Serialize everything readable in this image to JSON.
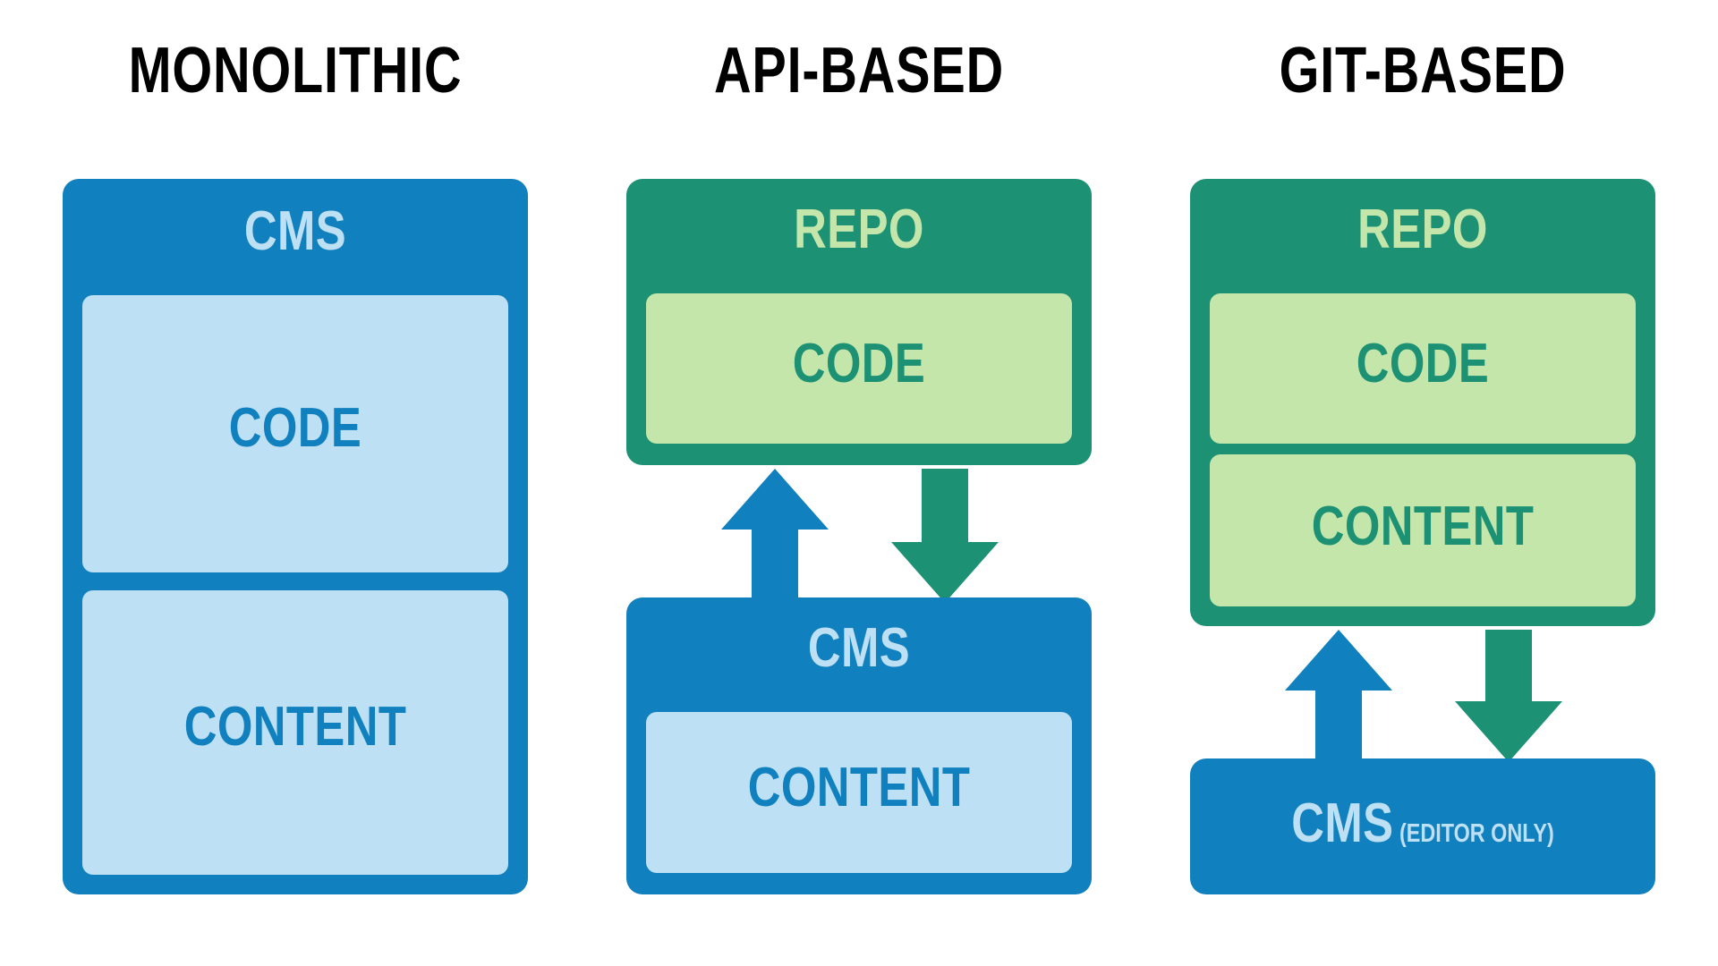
{
  "diagram": {
    "title_row": [
      "MONOLITHIC",
      "API-BASED",
      "GIT-BASED"
    ],
    "colors": {
      "blue_dark": "#1180BE",
      "blue_light": "#BEE0F5",
      "green_dark": "#1C9173",
      "green_light": "#C5E6AB",
      "title_text": "#000000",
      "background": "#FFFFFF"
    },
    "columns": [
      {
        "title": "MONOLITHIC",
        "outer": {
          "label": "CMS",
          "kind": "blue"
        },
        "inner": [
          {
            "label": "CODE",
            "kind": "blue"
          },
          {
            "label": "CONTENT",
            "kind": "blue"
          }
        ],
        "arrows": []
      },
      {
        "title": "API-BASED",
        "outer": {
          "label": "REPO",
          "kind": "green"
        },
        "inner": [
          {
            "label": "CODE",
            "kind": "green"
          }
        ],
        "secondary": {
          "label": "CMS",
          "kind": "blue",
          "inner": [
            {
              "label": "CONTENT",
              "kind": "blue"
            }
          ]
        },
        "arrows": [
          {
            "direction": "up",
            "color": "blue",
            "from": "CMS",
            "to": "REPO"
          },
          {
            "direction": "down",
            "color": "green",
            "from": "REPO",
            "to": "CMS"
          }
        ]
      },
      {
        "title": "GIT-BASED",
        "outer": {
          "label": "REPO",
          "kind": "green"
        },
        "inner": [
          {
            "label": "CODE",
            "kind": "green"
          },
          {
            "label": "CONTENT",
            "kind": "green"
          }
        ],
        "secondary": {
          "label": "CMS",
          "sub_label": "(EDITOR ONLY)",
          "kind": "blue",
          "inner": []
        },
        "arrows": [
          {
            "direction": "up",
            "color": "blue",
            "from": "CMS",
            "to": "REPO"
          },
          {
            "direction": "down",
            "color": "green",
            "from": "REPO",
            "to": "CMS"
          }
        ]
      }
    ]
  }
}
